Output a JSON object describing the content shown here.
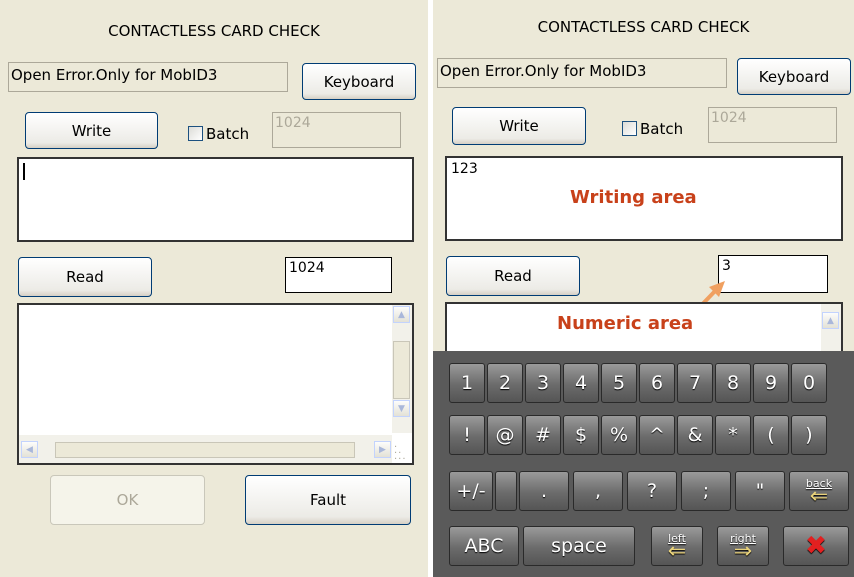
{
  "left": {
    "title": "CONTACTLESS CARD CHECK",
    "status_text": "Open Error.Only for MobID3",
    "keyboard_label": "Keyboard",
    "write_label": "Write",
    "batch_label": "Batch",
    "batch_value": "1024",
    "write_text": "",
    "read_label": "Read",
    "read_count": "1024",
    "read_text": "",
    "ok_label": "OK",
    "fault_label": "Fault"
  },
  "right": {
    "title": "CONTACTLESS CARD CHECK",
    "status_text": "Open Error.Only for MobID3",
    "keyboard_label": "Keyboard",
    "write_label": "Write",
    "batch_label": "Batch",
    "batch_value": "1024",
    "write_text": "123",
    "writing_area_annotation": "Writing area",
    "read_label": "Read",
    "read_count": "3",
    "numeric_area_annotation": "Numeric area"
  },
  "keyboard": {
    "row1": [
      "1",
      "2",
      "3",
      "4",
      "5",
      "6",
      "7",
      "8",
      "9",
      "0"
    ],
    "row2": [
      "!",
      "@",
      "#",
      "$",
      "%",
      "^",
      "&",
      "*",
      "(",
      ")"
    ],
    "row3": [
      "+/-",
      "",
      ".",
      ",",
      "?",
      ";",
      "\""
    ],
    "back_label": "back",
    "abc_label": "ABC",
    "space_label": "space",
    "left_label": "left",
    "right_label": "right",
    "close_icon": "close-icon"
  },
  "colors": {
    "annotation": "#c8411a",
    "arrow": "#f0a060",
    "window_bg": "#ece9d8"
  }
}
